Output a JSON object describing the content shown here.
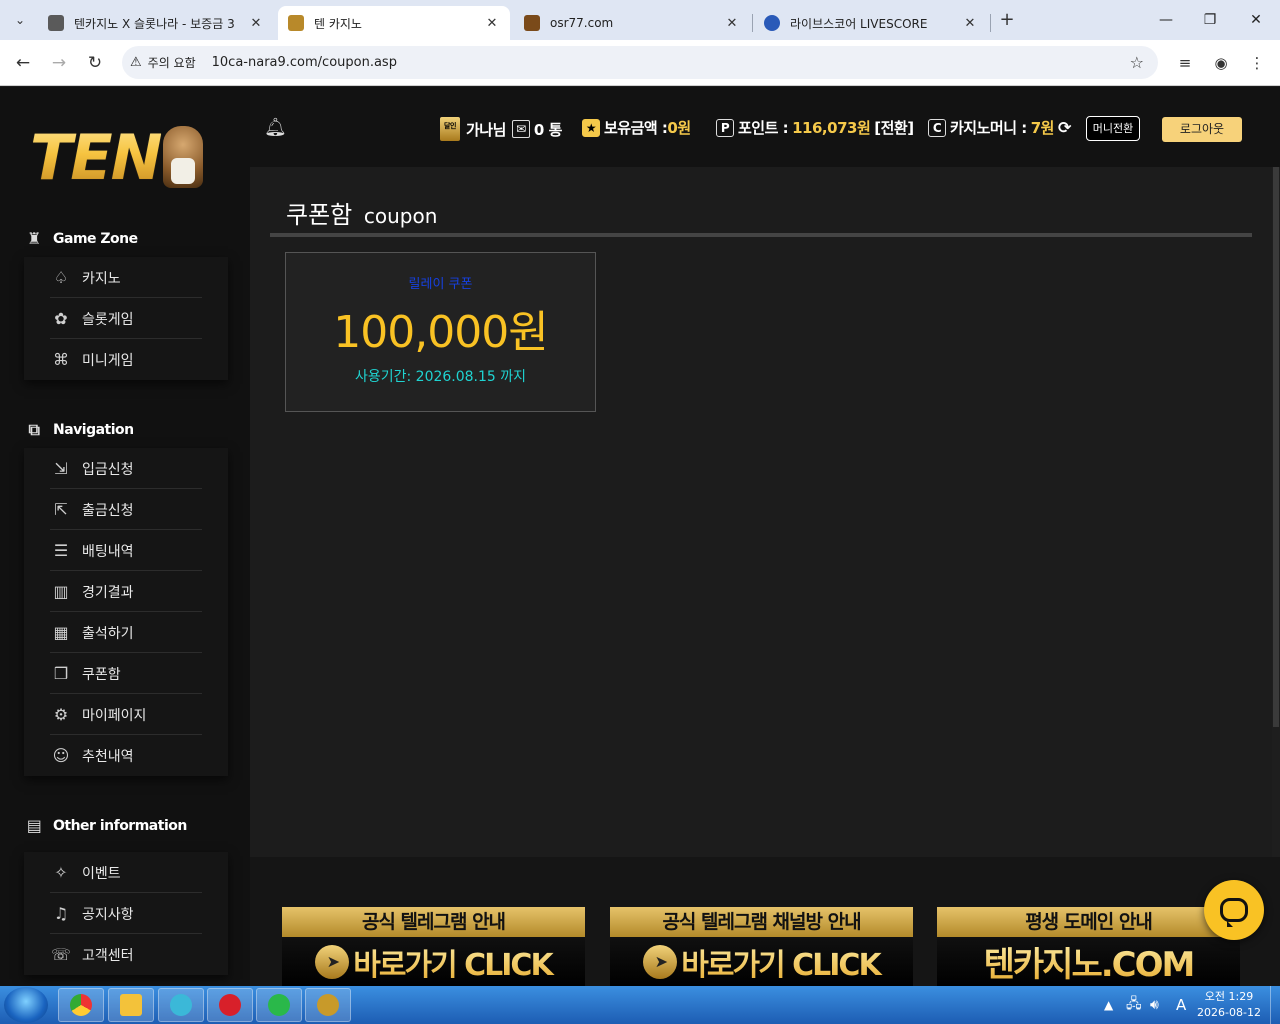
{
  "browser": {
    "tabs": [
      {
        "title": "텐카지노 X 슬롯나라 - 보증금 3",
        "favicon_color": "#5a5a5a",
        "active": false
      },
      {
        "title": "텐 카지노",
        "favicon_color": "#b8892a",
        "active": true
      },
      {
        "title": "osr77.com",
        "favicon_color": "#7a4a1a",
        "active": false
      },
      {
        "title": "라이브스코어 LIVESCORE",
        "favicon_color": "#2a5ab8",
        "active": false
      }
    ],
    "security_warning": "주의 요함",
    "url": "10ca-nara9.com/coupon.asp"
  },
  "sidebar": {
    "game_zone": {
      "title": "Game Zone",
      "items": [
        {
          "label": "카지노",
          "icon": "spade-icon",
          "glyph": "♤"
        },
        {
          "label": "슬롯게임",
          "icon": "cherry-icon",
          "glyph": "✿"
        },
        {
          "label": "미니게임",
          "icon": "gamepad-icon",
          "glyph": "⌘"
        }
      ]
    },
    "navigation": {
      "title": "Navigation",
      "items": [
        {
          "label": "입금신청",
          "icon": "deposit-icon",
          "glyph": "⇲"
        },
        {
          "label": "출금신청",
          "icon": "withdraw-icon",
          "glyph": "⇱"
        },
        {
          "label": "배팅내역",
          "icon": "betting-history-icon",
          "glyph": "☰"
        },
        {
          "label": "경기결과",
          "icon": "results-icon",
          "glyph": "▥"
        },
        {
          "label": "출석하기",
          "icon": "calendar-icon",
          "glyph": "▦"
        },
        {
          "label": "쿠폰함",
          "icon": "gift-box-icon",
          "glyph": "❒"
        },
        {
          "label": "마이페이지",
          "icon": "user-settings-icon",
          "glyph": "⚙"
        },
        {
          "label": "추천내역",
          "icon": "referral-icon",
          "glyph": "☺"
        }
      ]
    },
    "other": {
      "title": "Other information",
      "items": [
        {
          "label": "이벤트",
          "icon": "gift-icon",
          "glyph": "✧"
        },
        {
          "label": "공지사항",
          "icon": "bell-icon",
          "glyph": "♫"
        },
        {
          "label": "고객센터",
          "icon": "headset-icon",
          "glyph": "☏"
        }
      ]
    }
  },
  "header": {
    "user_name": "가나님",
    "messages": "0 통",
    "balance_label": "보유금액 :",
    "balance_value": "0원",
    "points_label": "포인트 :",
    "points_value": "116,073원",
    "points_convert": "[전환]",
    "casino_money_label": "카지노머니 :",
    "casino_money_value": "7원",
    "money_convert_button": "머니전환",
    "logout_button": "로그아웃"
  },
  "content": {
    "title": "쿠폰함",
    "title_en": "coupon",
    "coupon": {
      "name": "릴레이 쿠폰",
      "amount": "100,000원",
      "period": "사용기간: 2026.08.15 까지"
    }
  },
  "banners": [
    {
      "top": "공식 텔레그램 안내",
      "bottom": "바로가기 CLICK"
    },
    {
      "top": "공식 텔레그램 채널방 안내",
      "bottom": "바로가기 CLICK"
    },
    {
      "top": "평생 도메인 안내",
      "bottom": "텐카지노.COM"
    }
  ],
  "taskbar": {
    "time": "오전 1:29",
    "date": "2026-08-12",
    "ime": "A"
  }
}
